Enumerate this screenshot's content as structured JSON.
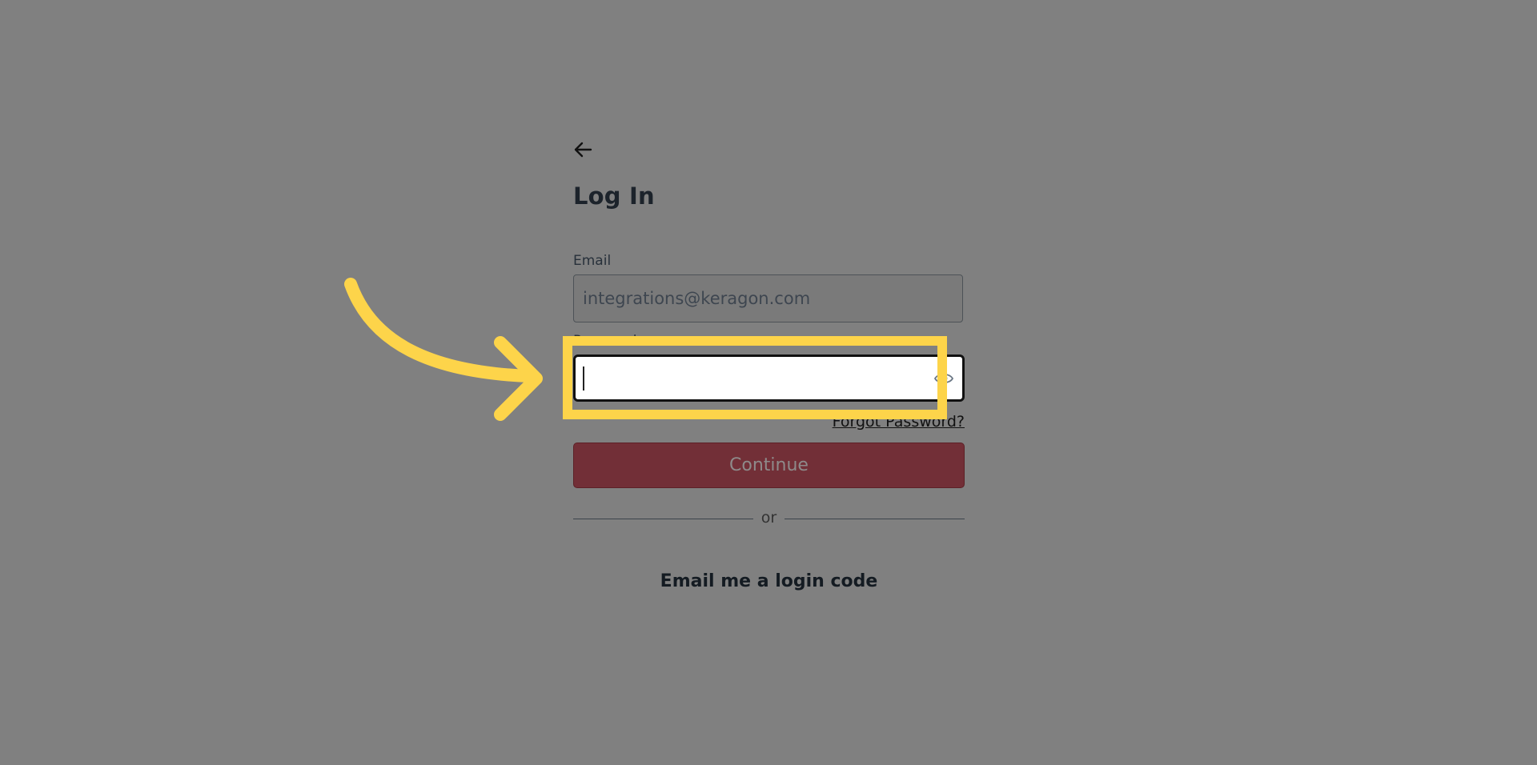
{
  "login": {
    "title": "Log In",
    "email_label": "Email",
    "email_value": "integrations@keragon.com",
    "password_label": "Password",
    "password_value": "",
    "forgot_password": "Forgot Password?",
    "continue_label": "Continue",
    "divider_text": "or",
    "email_code_link": "Email me a login code"
  },
  "icons": {
    "back": "arrow-left-icon",
    "password_toggle": "eye-icon"
  },
  "annotation": {
    "highlight_color": "#fdd44a",
    "arrow_color": "#fdd44a"
  },
  "colors": {
    "overlay": "#808080",
    "continue_button": "#722f37"
  }
}
